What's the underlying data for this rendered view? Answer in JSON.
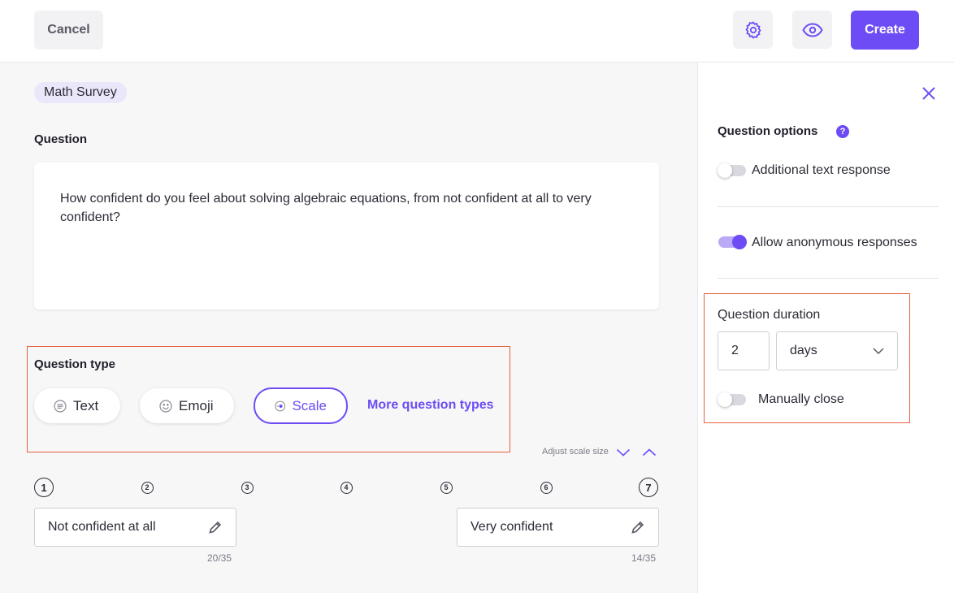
{
  "header": {
    "cancel_label": "Cancel",
    "create_label": "Create",
    "settings_icon": "gear-icon",
    "preview_icon": "eye-icon"
  },
  "survey": {
    "name": "Math Survey"
  },
  "question": {
    "label": "Question",
    "text": "How confident do you feel about solving algebraic equations, from not confident at all to very confident?"
  },
  "question_type": {
    "label": "Question type",
    "options": [
      {
        "label": "Text",
        "icon": "text-lines-icon"
      },
      {
        "label": "Emoji",
        "icon": "smiley-icon"
      },
      {
        "label": "Scale",
        "icon": "scale-dot-icon",
        "selected": true
      }
    ],
    "more_label": "More question types"
  },
  "scale": {
    "adjust_label": "Adjust scale size",
    "numbers": [
      "1",
      "2",
      "3",
      "4",
      "5",
      "6",
      "7"
    ],
    "min_label": "Not confident at all",
    "min_counter": "20/35",
    "max_label": "Very confident",
    "max_counter": "14/35"
  },
  "options_panel": {
    "title": "Question options",
    "help": "?",
    "additional_text": {
      "label": "Additional text response",
      "enabled": false
    },
    "anonymous": {
      "label": "Allow anonymous responses",
      "enabled": true
    },
    "duration": {
      "label": "Question duration",
      "value": "2",
      "unit": "days",
      "manual_close": {
        "label": "Manually close",
        "enabled": false
      }
    }
  },
  "colors": {
    "accent": "#6e4cf5",
    "highlight": "#e4603f"
  }
}
